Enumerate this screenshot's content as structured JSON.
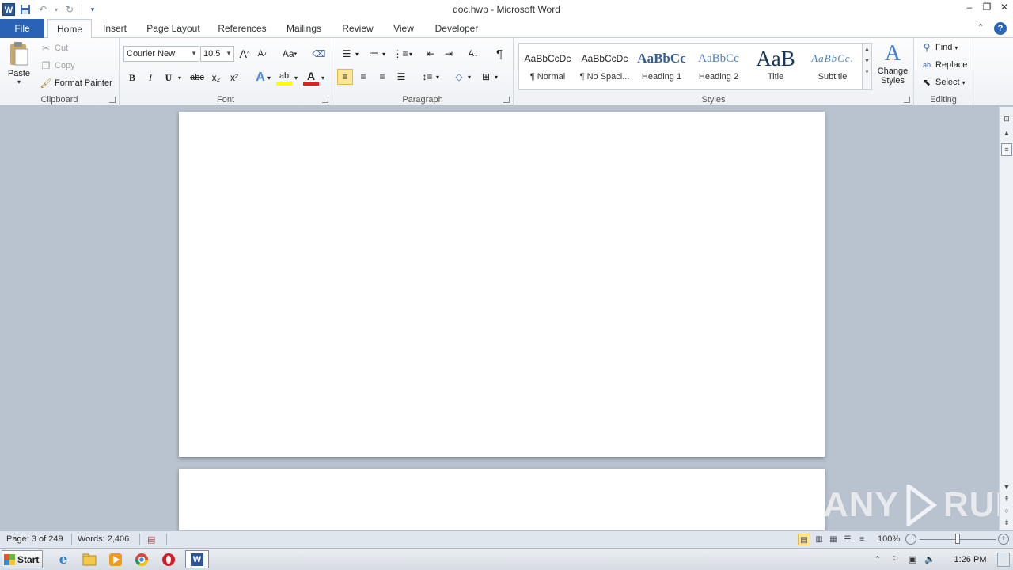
{
  "window": {
    "title": "doc.hwp - Microsoft Word",
    "app_icon_letter": "W"
  },
  "tabs": [
    {
      "label": "File"
    },
    {
      "label": "Home"
    },
    {
      "label": "Insert"
    },
    {
      "label": "Page Layout"
    },
    {
      "label": "References"
    },
    {
      "label": "Mailings"
    },
    {
      "label": "Review"
    },
    {
      "label": "View"
    },
    {
      "label": "Developer"
    }
  ],
  "ribbon": {
    "clipboard": {
      "label": "Clipboard",
      "paste": "Paste",
      "cut": "Cut",
      "copy": "Copy",
      "format_painter": "Format Painter"
    },
    "font": {
      "label": "Font",
      "font_name": "Courier New",
      "font_size": "10.5",
      "bold": "B",
      "italic": "I",
      "underline": "U",
      "strikethrough": "abc",
      "subscript": "x₂",
      "superscript": "x²",
      "change_case": "Aa",
      "grow": "A",
      "shrink": "A",
      "font_color": "A",
      "text_effects": "A",
      "highlight": "ab"
    },
    "paragraph": {
      "label": "Paragraph",
      "pilcrow": "¶"
    },
    "styles": {
      "label": "Styles",
      "items": [
        {
          "sample": "AaBbCcDc",
          "name": "¶ Normal"
        },
        {
          "sample": "AaBbCcDc",
          "name": "¶ No Spaci..."
        },
        {
          "sample": "AaBbCc",
          "name": "Heading 1"
        },
        {
          "sample": "AaBbCc",
          "name": "Heading 2"
        },
        {
          "sample": "AaB",
          "name": "Title"
        },
        {
          "sample": "AaBbCc.",
          "name": "Subtitle"
        }
      ],
      "change_styles_line1": "Change",
      "change_styles_line2": "Styles"
    },
    "editing": {
      "label": "Editing",
      "find": "Find",
      "replace": "Replace",
      "select": "Select"
    }
  },
  "statusbar": {
    "page": "Page: 3 of 249",
    "words": "Words: 2,406",
    "zoom": "100%",
    "zoom_fraction": 0.5
  },
  "watermark": {
    "text_left": "ANY",
    "text_right": "RUN"
  },
  "taskbar": {
    "start": "Start",
    "clock": "1:26 PM"
  },
  "colors": {
    "file_tab": "#2a62b5",
    "doc_background": "#b9c3cf",
    "heading_blue": "#365f91",
    "title_blue": "#17365d",
    "subtitle_blue": "#4f81bd",
    "highlight_yellow": "#fce694"
  }
}
